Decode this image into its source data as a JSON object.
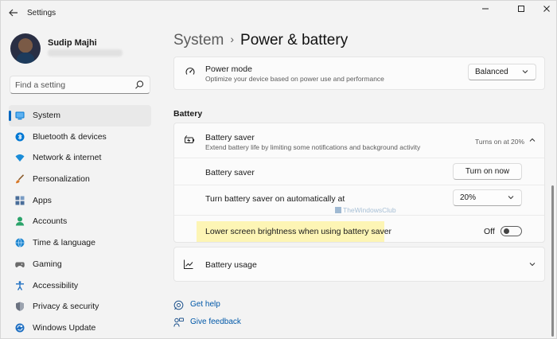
{
  "window": {
    "app_title": "Settings",
    "back_icon": "back-arrow-icon",
    "minimize_icon": "minimize-icon",
    "maximize_icon": "maximize-icon",
    "close_icon": "close-icon"
  },
  "profile": {
    "name": "Sudip Majhi",
    "avatar_icon": "avatar"
  },
  "search": {
    "placeholder": "Find a setting",
    "value": ""
  },
  "sidebar": {
    "items": [
      {
        "label": "System",
        "icon": "monitor-icon",
        "color": "#0078d4",
        "active": true
      },
      {
        "label": "Bluetooth & devices",
        "icon": "bluetooth-icon",
        "color": "#0078d4"
      },
      {
        "label": "Network & internet",
        "icon": "wifi-icon",
        "color": "#1a8cd8"
      },
      {
        "label": "Personalization",
        "icon": "brush-icon",
        "color": "#d87a2a"
      },
      {
        "label": "Apps",
        "icon": "apps-icon",
        "color": "#4a6e9a"
      },
      {
        "label": "Accounts",
        "icon": "person-icon",
        "color": "#2aa36a"
      },
      {
        "label": "Time & language",
        "icon": "globe-clock-icon",
        "color": "#1e86d0"
      },
      {
        "label": "Gaming",
        "icon": "gamepad-icon",
        "color": "#6b6b6b"
      },
      {
        "label": "Accessibility",
        "icon": "accessibility-icon",
        "color": "#1e6fc2"
      },
      {
        "label": "Privacy & security",
        "icon": "shield-icon",
        "color": "#6b7280"
      },
      {
        "label": "Windows Update",
        "icon": "update-icon",
        "color": "#1e6fc2"
      }
    ]
  },
  "breadcrumb": {
    "parent": "System",
    "separator": "›",
    "current": "Power & battery"
  },
  "power_mode": {
    "title": "Power mode",
    "description": "Optimize your device based on power use and performance",
    "selected": "Balanced"
  },
  "battery": {
    "section_label": "Battery",
    "saver": {
      "title": "Battery saver",
      "description": "Extend battery life by limiting some notifications and background activity",
      "status": "Turns on at 20%",
      "row_saver_label": "Battery saver",
      "turn_on_label": "Turn on now",
      "auto_label": "Turn battery saver on automatically at",
      "auto_value": "20%",
      "brightness_label": "Lower screen brightness when using battery saver",
      "brightness_state": "Off"
    },
    "usage": {
      "title": "Battery usage"
    }
  },
  "watermark": "TheWindowsClub",
  "links": {
    "help": "Get help",
    "feedback": "Give feedback"
  }
}
